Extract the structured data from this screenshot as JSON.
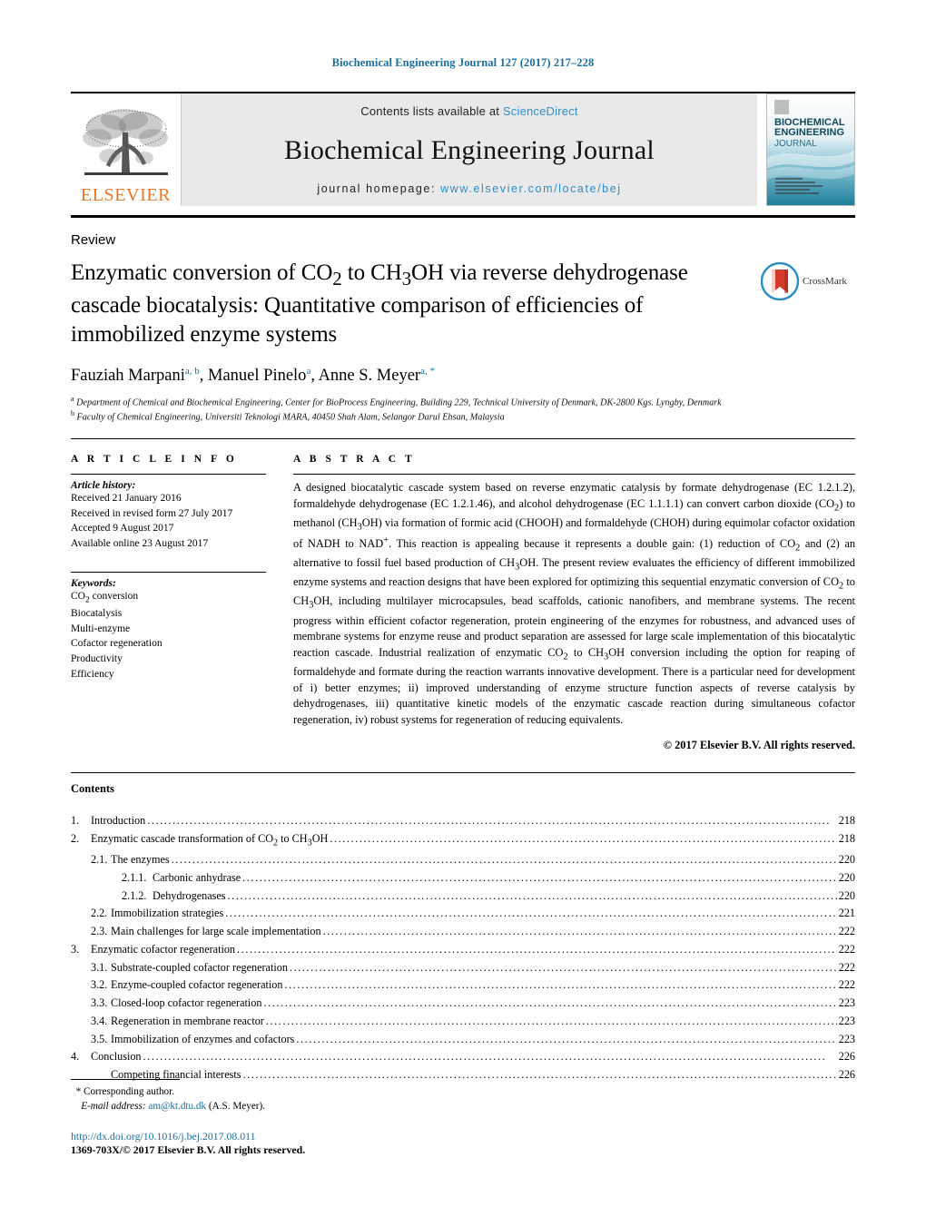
{
  "running_head": "Biochemical Engineering Journal 127 (2017) 217–228",
  "masthead": {
    "publisher_name": "ELSEVIER",
    "contents_prefix": "Contents lists available at",
    "sciencedirect": "ScienceDirect",
    "journal_name": "Biochemical Engineering Journal",
    "homepage_label": "journal homepage:",
    "homepage_url": "www.elsevier.com/locate/bej",
    "cover_line1": "BIOCHEMICAL",
    "cover_line2": "ENGINEERING",
    "cover_line3": "JOURNAL",
    "link_color": "#2c8ecb"
  },
  "article": {
    "type": "Review",
    "title": "Enzymatic conversion of CO2 to CH3OH via reverse dehydrogenase cascade biocatalysis: Quantitative comparison of efficiencies of immobilized enzyme systems",
    "crossmark_label": "CrossMark",
    "authors": [
      {
        "name": "Fauziah Marpani",
        "sup": "a, b"
      },
      {
        "name": "Manuel Pinelo",
        "sup": "a"
      },
      {
        "name": "Anne S. Meyer",
        "sup": "a, *"
      }
    ],
    "affiliations": [
      {
        "marker": "a",
        "text": "Department of Chemical and Biochemical Engineering, Center for BioProcess Engineering, Building 229, Technical University of Denmark, DK-2800 Kgs. Lyngby, Denmark"
      },
      {
        "marker": "b",
        "text": "Faculty of Chemical Engineering, Universiti Teknologi MARA, 40450 Shah Alam, Selangor Darul Ehsan, Malaysia"
      }
    ]
  },
  "article_info": {
    "heading": "A R T I C L E   I N F O",
    "history_label": "Article history:",
    "history": [
      "Received 21 January 2016",
      "Received in revised form 27 July 2017",
      "Accepted 9 August 2017",
      "Available online 23 August 2017"
    ],
    "keywords_label": "Keywords:",
    "keywords": [
      "CO2 conversion",
      "Biocatalysis",
      "Multi-enzyme",
      "Cofactor regeneration",
      "Productivity",
      "Efficiency"
    ]
  },
  "abstract": {
    "heading": "A B S T R A C T",
    "body": "A designed biocatalytic cascade system based on reverse enzymatic catalysis by formate dehydrogenase (EC 1.2.1.2), formaldehyde dehydrogenase (EC 1.2.1.46), and alcohol dehydrogenase (EC 1.1.1.1) can convert carbon dioxide (CO2) to methanol (CH3OH) via formation of formic acid (CHOOH) and formaldehyde (CHOH) during equimolar cofactor oxidation of NADH to NAD+. This reaction is appealing because it represents a double gain: (1) reduction of CO2 and (2) an alternative to fossil fuel based production of CH3OH. The present review evaluates the efficiency of different immobilized enzyme systems and reaction designs that have been explored for optimizing this sequential enzymatic conversion of CO2 to CH3OH, including multilayer microcapsules, bead scaffolds, cationic nanofibers, and membrane systems. The recent progress within efficient cofactor regeneration, protein engineering of the enzymes for robustness, and advanced uses of membrane systems for enzyme reuse and product separation are assessed for large scale implementation of this biocatalytic reaction cascade. Industrial realization of enzymatic CO2 to CH3OH conversion including the option for reaping of formaldehyde and formate during the reaction warrants innovative development. There is a particular need for development of i) better enzymes; ii) improved understanding of enzyme structure function aspects of reverse catalysis by dehydrogenases, iii) quantitative kinetic models of the enzymatic cascade reaction during simultaneous cofactor regeneration, iv) robust systems for regeneration of reducing equivalents.",
    "copyright": "© 2017 Elsevier B.V. All rights reserved."
  },
  "contents": {
    "heading": "Contents",
    "entries": [
      {
        "level": 1,
        "num": "1.",
        "label": "Introduction",
        "page": "218"
      },
      {
        "level": 1,
        "num": "2.",
        "label": "Enzymatic cascade transformation of CO2 to CH3OH",
        "page": "218"
      },
      {
        "level": 2,
        "num": "2.1.",
        "label": "The enzymes",
        "page": "220"
      },
      {
        "level": 3,
        "num": "2.1.1.",
        "label": "Carbonic anhydrase",
        "page": "220"
      },
      {
        "level": 3,
        "num": "2.1.2.",
        "label": "Dehydrogenases",
        "page": "220"
      },
      {
        "level": 2,
        "num": "2.2.",
        "label": "Immobilization strategies",
        "page": "221"
      },
      {
        "level": 2,
        "num": "2.3.",
        "label": "Main challenges for large scale implementation",
        "page": "222"
      },
      {
        "level": 1,
        "num": "3.",
        "label": "Enzymatic cofactor regeneration",
        "page": "222"
      },
      {
        "level": 2,
        "num": "3.1.",
        "label": "Substrate-coupled cofactor regeneration",
        "page": "222"
      },
      {
        "level": 2,
        "num": "3.2.",
        "label": "Enzyme-coupled cofactor regeneration",
        "page": "222"
      },
      {
        "level": 2,
        "num": "3.3.",
        "label": "Closed-loop cofactor regeneration",
        "page": "223"
      },
      {
        "level": 2,
        "num": "3.4.",
        "label": "Regeneration in membrane reactor",
        "page": "223"
      },
      {
        "level": 2,
        "num": "3.5.",
        "label": "Immobilization of enzymes and cofactors",
        "page": "223"
      },
      {
        "level": 1,
        "num": "4.",
        "label": "Conclusion",
        "page": "226"
      },
      {
        "level": 0,
        "num": "",
        "label": "Competing financial interests",
        "page": "226"
      }
    ]
  },
  "footer": {
    "corresponding_marker": "*",
    "corresponding_label": "Corresponding author.",
    "email_label": "E-mail address:",
    "email": "am@kt.dtu.dk",
    "email_owner": "(A.S. Meyer).",
    "doi": "http://dx.doi.org/10.1016/j.bej.2017.08.011",
    "issn": "1369-703X/© 2017 Elsevier B.V. All rights reserved."
  }
}
